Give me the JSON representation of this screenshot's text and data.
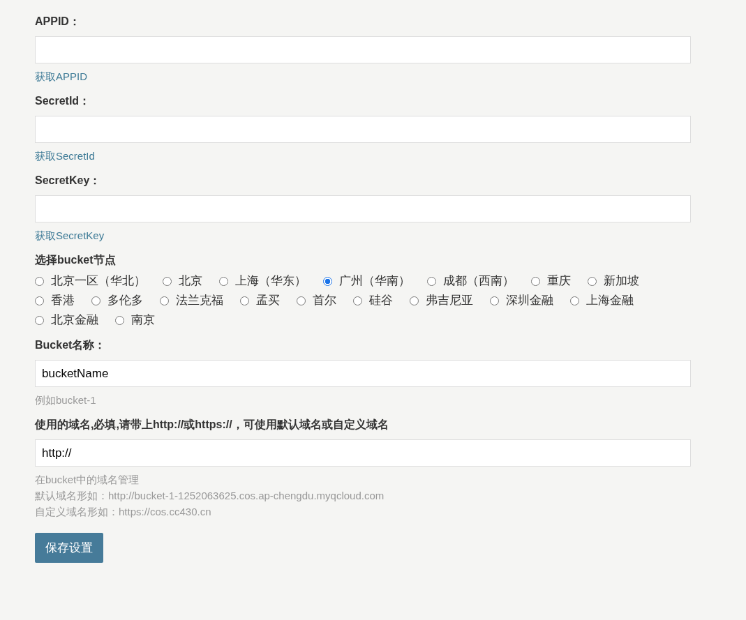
{
  "sections": [
    {
      "kind": "input",
      "label": "APPID：",
      "notes": [
        {
          "kind": "link",
          "text": "获取APPID"
        }
      ]
    },
    {
      "kind": "input",
      "label": "SecretId：",
      "notes": [
        {
          "kind": "link",
          "text": "获取SecretId"
        }
      ]
    },
    {
      "kind": "input",
      "label": "SecretKey：",
      "notes": [
        {
          "kind": "link",
          "text": "获取SecretKey"
        }
      ]
    },
    {
      "kind": "radio",
      "label": "选择bucket节点",
      "options": [
        {
          "label": "北京一区（华北）",
          "selected": false
        },
        {
          "label": "北京",
          "selected": false
        },
        {
          "label": "上海（华东）",
          "selected": false
        },
        {
          "label": "广州（华南）",
          "selected": true
        },
        {
          "label": "成都（西南）",
          "selected": false
        },
        {
          "label": "重庆",
          "selected": false
        },
        {
          "label": "新加坡",
          "selected": false
        },
        {
          "label": "香港",
          "selected": false
        },
        {
          "label": "多伦多",
          "selected": false
        },
        {
          "label": "法兰克福",
          "selected": false
        },
        {
          "label": "孟买",
          "selected": false
        },
        {
          "label": "首尔",
          "selected": false
        },
        {
          "label": "硅谷",
          "selected": false
        },
        {
          "label": "弗吉尼亚",
          "selected": false
        },
        {
          "label": "深圳金融",
          "selected": false
        },
        {
          "label": "上海金融",
          "selected": false
        },
        {
          "label": "北京金融",
          "selected": false
        },
        {
          "label": "南京",
          "selected": false
        }
      ]
    },
    {
      "kind": "input",
      "label": "Bucket名称：",
      "value": "bucketName",
      "notes": [
        {
          "kind": "hint",
          "text": "例如bucket-1"
        }
      ]
    },
    {
      "kind": "input",
      "label": "使用的域名,必填,请带上http://或https://，可使用默认域名或自定义域名",
      "value": "http://",
      "notes": [
        {
          "kind": "hint",
          "text": "在bucket中的域名管理"
        },
        {
          "kind": "hint",
          "text": "默认域名形如：http://bucket-1-1252063625.cos.ap-chengdu.myqcloud.com"
        },
        {
          "kind": "hint",
          "text": "自定义域名形如：https://cos.cc430.cn"
        }
      ]
    }
  ],
  "save_button": "保存设置"
}
